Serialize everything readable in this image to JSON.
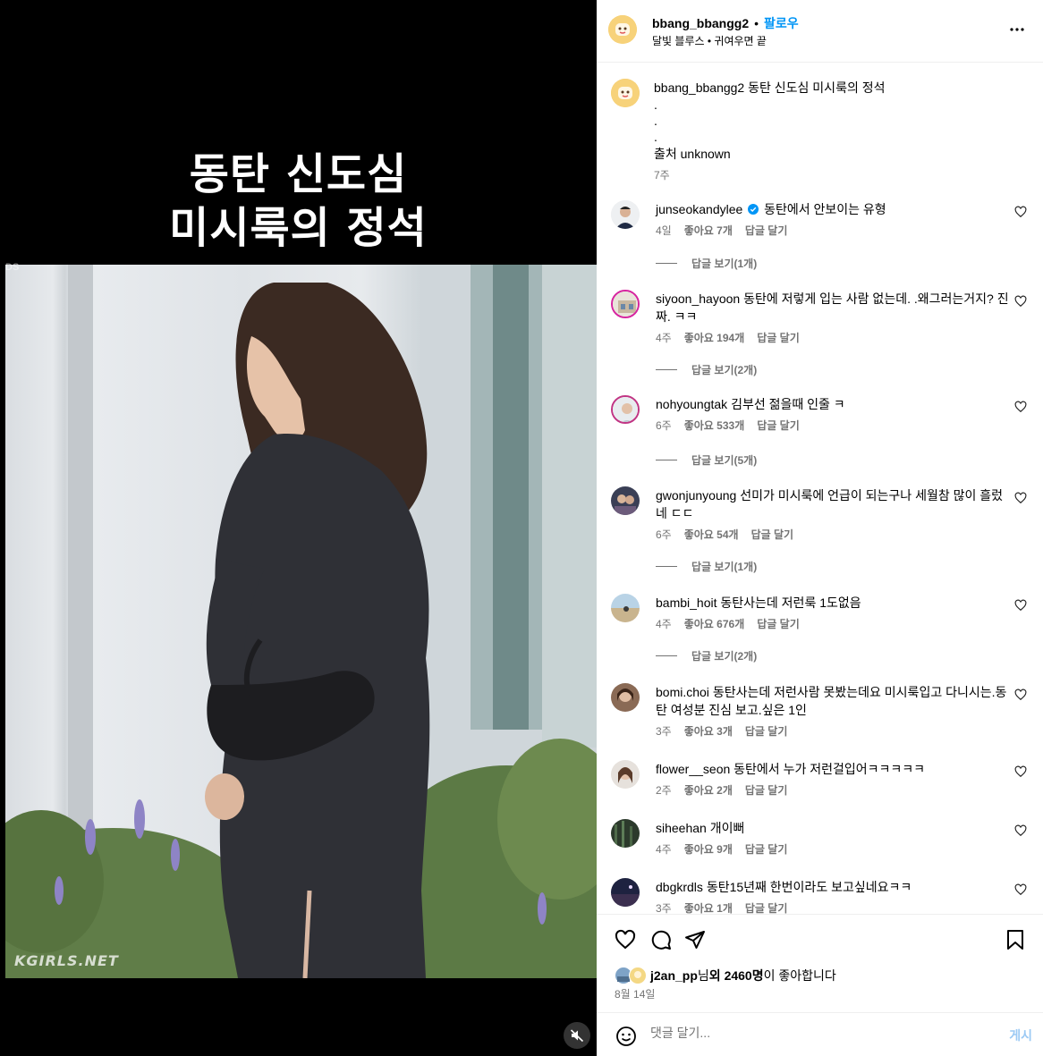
{
  "media": {
    "headline_line1": "동탄 신도심",
    "headline_line2": "미시룩의 정석",
    "watermark": "KGIRLS.NET",
    "corner_mark": "DS",
    "mute_icon": "speaker-muted-icon"
  },
  "header": {
    "username": "bbang_bbangg2",
    "separator": "•",
    "follow_label": "팔로우",
    "audio": "달빛 블루스 • 귀여우면 끝",
    "more_icon": "more-horizontal-icon"
  },
  "caption": {
    "username": "bbang_bbangg2",
    "text": "동탄 신도심 미시룩의 정석",
    "dots": [
      ".",
      ".",
      "."
    ],
    "source": "출처 unknown",
    "time": "7주"
  },
  "comments": [
    {
      "username": "junseokandylee",
      "verified": true,
      "text": "동탄에서 안보이는 유형",
      "time": "4일",
      "likes": "좋아요 7개",
      "reply": "답글 달기",
      "view_replies": "답글 보기(1개)"
    },
    {
      "username": "siyoon_hayoon",
      "text": "동탄에 저렇게 입는 사람 없는데. .왜그러는거지? 진짜. ㅋㅋ",
      "time": "4주",
      "likes": "좋아요 194개",
      "reply": "답글 달기",
      "view_replies": "답글 보기(2개)"
    },
    {
      "username": "nohyoungtak",
      "text": "김부선 젊을때 인줄 ㅋ",
      "time": "6주",
      "likes": "좋아요 533개",
      "reply": "답글 달기",
      "view_replies": "답글 보기(5개)"
    },
    {
      "username": "gwonjunyoung",
      "text": "선미가 미시룩에 언급이 되는구나 세월참 많이 흘렀네 ㄷㄷ",
      "time": "6주",
      "likes": "좋아요 54개",
      "reply": "답글 달기",
      "view_replies": "답글 보기(1개)"
    },
    {
      "username": "bambi_hoit",
      "text": "동탄사는데 저런룩 1도없음",
      "time": "4주",
      "likes": "좋아요 676개",
      "reply": "답글 달기",
      "view_replies": "답글 보기(2개)"
    },
    {
      "username": "bomi.choi",
      "text": "동탄사는데 저런사람 못봤는데요 미시룩입고 다니시는.동탄 여성분 진심 보고.싶은 1인",
      "time": "3주",
      "likes": "좋아요 3개",
      "reply": "답글 달기"
    },
    {
      "username": "flower__seon",
      "text": "동탄에서 누가 저런걸입어ㅋㅋㅋㅋㅋ",
      "time": "2주",
      "likes": "좋아요 2개",
      "reply": "답글 달기"
    },
    {
      "username": "siheehan",
      "text": "개이뻐",
      "time": "4주",
      "likes": "좋아요 9개",
      "reply": "답글 달기"
    },
    {
      "username": "dbgkrdls",
      "text": "동탄15년째 한번이라도 보고싶네요ㅋㅋ",
      "time": "3주",
      "likes": "좋아요 1개",
      "reply": "답글 달기"
    }
  ],
  "actions": {
    "like_icon": "heart-icon",
    "comment_icon": "comment-icon",
    "share_icon": "paper-plane-icon",
    "save_icon": "bookmark-icon",
    "liked_by_user": "j2an_pp",
    "liked_by_mid": "님 ",
    "liked_by_count": "외 2460명",
    "liked_by_suffix": "이 좋아합니다",
    "date": "8월 14일"
  },
  "composer": {
    "emoji_icon": "emoji-icon",
    "placeholder": "댓글 달기...",
    "post_label": "게시"
  },
  "colors": {
    "accent": "#0095f6",
    "muted": "#737373",
    "post_disabled": "#9ccaf4",
    "verified": "#0095f6"
  }
}
